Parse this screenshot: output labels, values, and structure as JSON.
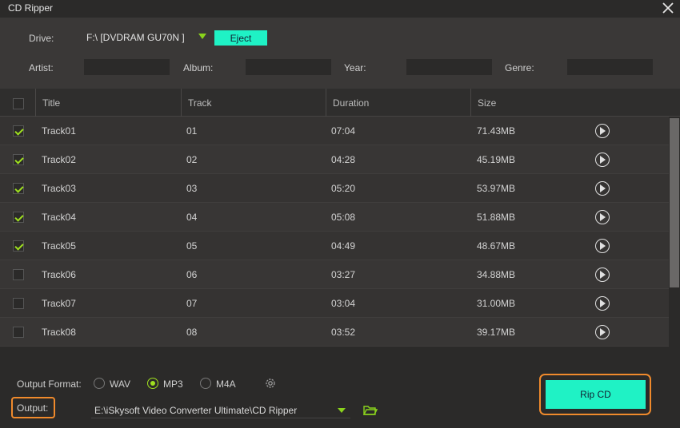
{
  "window": {
    "title": "CD Ripper",
    "close_icon": "close-icon"
  },
  "header": {
    "drive_label": "Drive:",
    "drive_value": "F:\\ [DVDRAM GU70N    ]",
    "eject_label": "Eject",
    "artist_label": "Artist:",
    "album_label": "Album:",
    "year_label": "Year:",
    "genre_label": "Genre:",
    "artist_value": "",
    "album_value": "",
    "year_value": "",
    "genre_value": ""
  },
  "table": {
    "columns": [
      "Title",
      "Track",
      "Duration",
      "Size"
    ],
    "rows": [
      {
        "checked": true,
        "title": "Track01",
        "track": "01",
        "duration": "07:04",
        "size": "71.43MB"
      },
      {
        "checked": true,
        "title": "Track02",
        "track": "02",
        "duration": "04:28",
        "size": "45.19MB"
      },
      {
        "checked": true,
        "title": "Track03",
        "track": "03",
        "duration": "05:20",
        "size": "53.97MB"
      },
      {
        "checked": true,
        "title": "Track04",
        "track": "04",
        "duration": "05:08",
        "size": "51.88MB"
      },
      {
        "checked": true,
        "title": "Track05",
        "track": "05",
        "duration": "04:49",
        "size": "48.67MB"
      },
      {
        "checked": false,
        "title": "Track06",
        "track": "06",
        "duration": "03:27",
        "size": "34.88MB"
      },
      {
        "checked": false,
        "title": "Track07",
        "track": "07",
        "duration": "03:04",
        "size": "31.00MB"
      },
      {
        "checked": false,
        "title": "Track08",
        "track": "08",
        "duration": "03:52",
        "size": "39.17MB"
      }
    ]
  },
  "footer": {
    "output_format_label": "Output Format:",
    "formats": [
      "WAV",
      "MP3",
      "M4A"
    ],
    "selected_format": "MP3",
    "output_label": "Output:",
    "output_path": "E:\\iSkysoft Video Converter Ultimate\\CD Ripper",
    "rip_label": "Rip CD"
  },
  "colors": {
    "accent": "#1ff2c5",
    "check": "#9fe01f",
    "highlight": "#f08a2c"
  }
}
